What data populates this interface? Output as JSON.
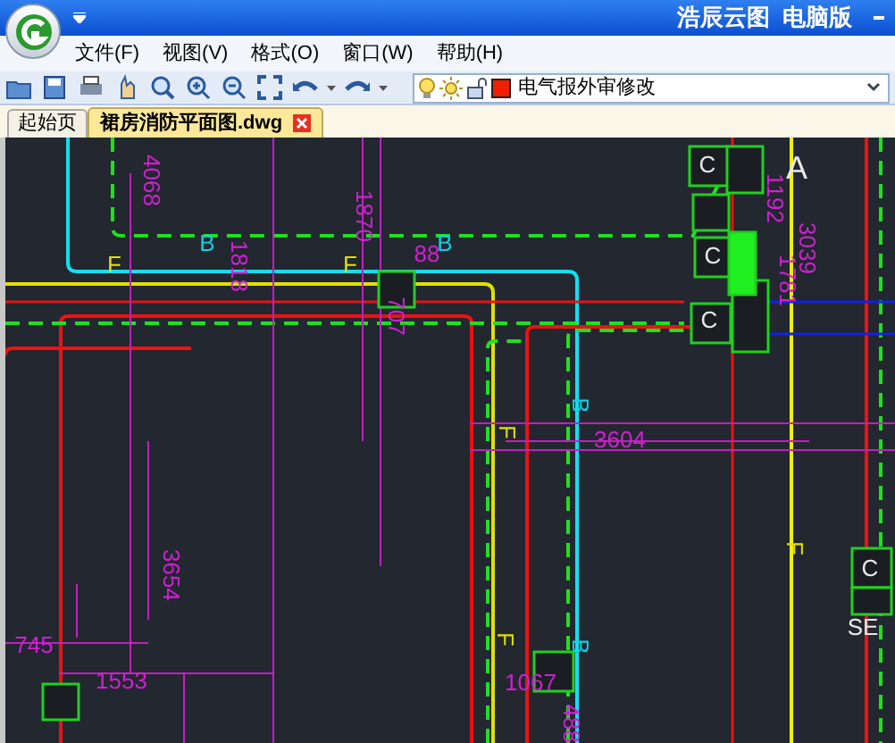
{
  "window": {
    "title": "浩辰云图  电脑版"
  },
  "menu": [
    "文件(F)",
    "视图(V)",
    "格式(O)",
    "窗口(W)",
    "帮助(H)"
  ],
  "toolbar": {
    "layer": "电气报外审修改"
  },
  "tabs": [
    {
      "label": "起始页",
      "selected": false
    },
    {
      "label": "裙房消防平面图.dwg",
      "selected": true
    }
  ],
  "drawing": {
    "labels": [
      {
        "text": "4068",
        "kind": "dimension"
      },
      {
        "text": "B",
        "kind": "pipe_b"
      },
      {
        "text": "F",
        "kind": "pipe_f"
      },
      {
        "text": "1818",
        "kind": "dimension"
      },
      {
        "text": "1870",
        "kind": "dimension"
      },
      {
        "text": "F",
        "kind": "pipe_f"
      },
      {
        "text": "88",
        "kind": "dimension"
      },
      {
        "text": "B",
        "kind": "pipe_b"
      },
      {
        "text": "707",
        "kind": "dimension"
      },
      {
        "text": "A",
        "kind": "axis"
      },
      {
        "text": "1192",
        "kind": "dimension"
      },
      {
        "text": "3039",
        "kind": "dimension"
      },
      {
        "text": "1781",
        "kind": "dimension"
      },
      {
        "text": "B",
        "kind": "pipe_b"
      },
      {
        "text": "3604",
        "kind": "dimension"
      },
      {
        "text": "F",
        "kind": "pipe_f"
      },
      {
        "text": "3654",
        "kind": "dimension"
      },
      {
        "text": "F",
        "kind": "pipe_f"
      },
      {
        "text": "745",
        "kind": "dimension"
      },
      {
        "text": "1553",
        "kind": "dimension"
      },
      {
        "text": "F",
        "kind": "pipe_f"
      },
      {
        "text": "1067",
        "kind": "dimension"
      },
      {
        "text": "B",
        "kind": "pipe_b"
      },
      {
        "text": "488",
        "kind": "dimension"
      },
      {
        "text": "SE",
        "kind": "axis"
      },
      {
        "text": "C",
        "kind": "equipment"
      },
      {
        "text": "C",
        "kind": "equipment"
      },
      {
        "text": "C",
        "kind": "equipment"
      },
      {
        "text": "C",
        "kind": "equipment"
      }
    ]
  }
}
